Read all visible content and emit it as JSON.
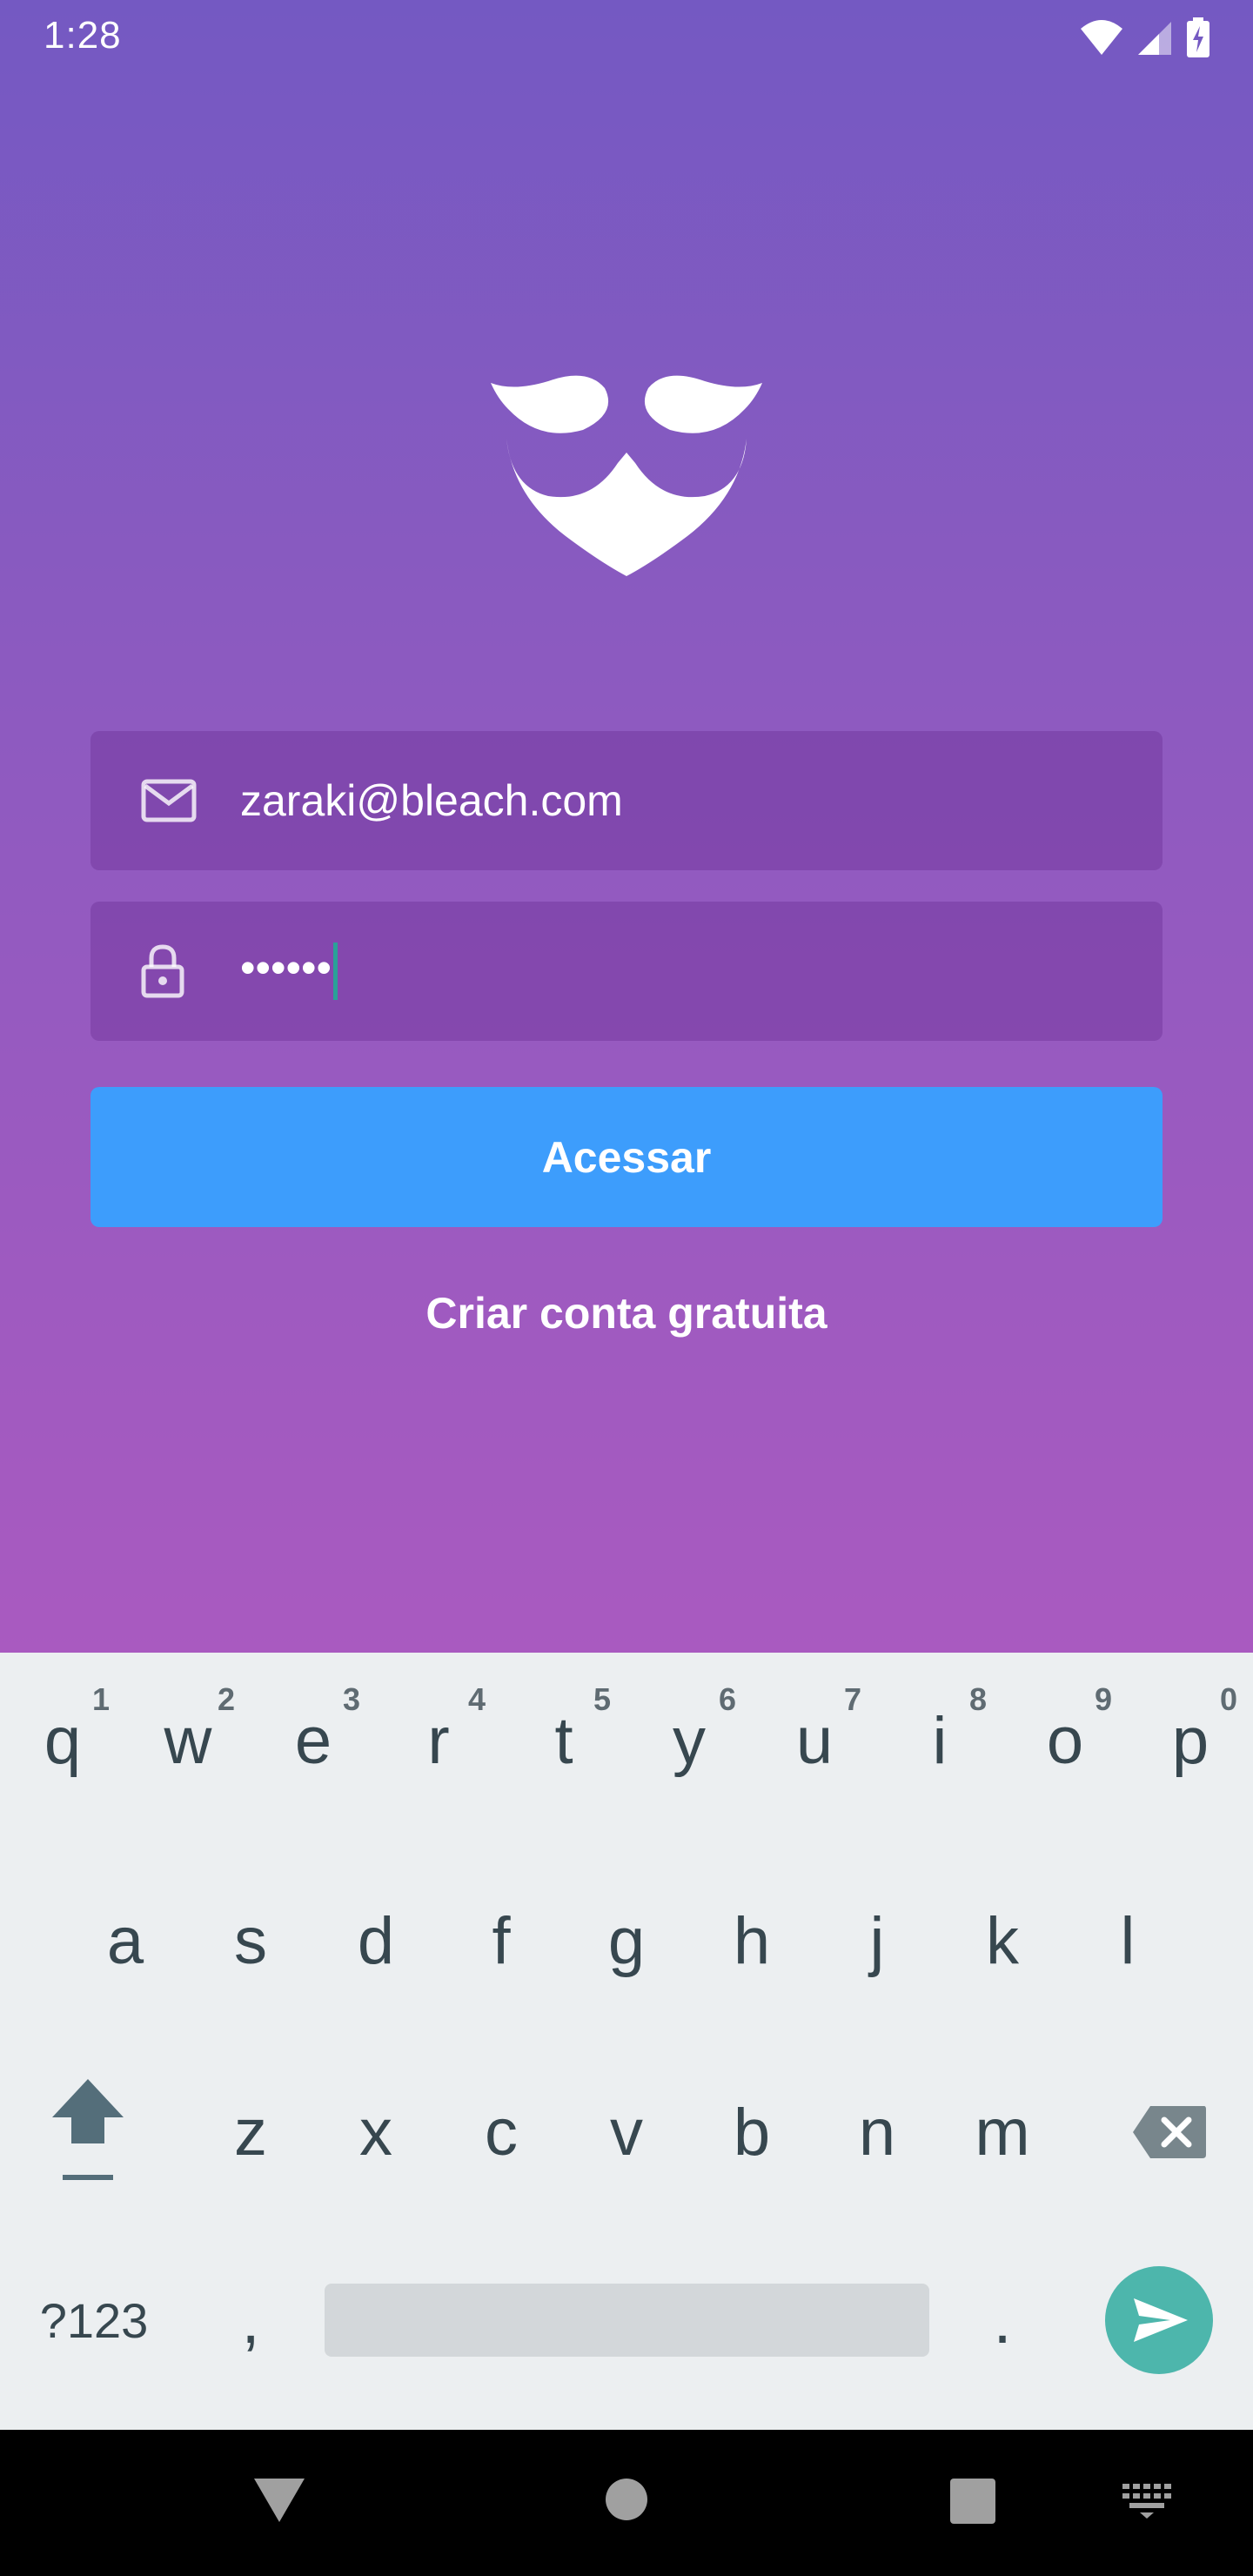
{
  "status_bar": {
    "time": "1:28",
    "icons": [
      "wifi-icon",
      "cell-signal-icon",
      "battery-charging-icon"
    ]
  },
  "login": {
    "logo": "mustache-beard-logo",
    "email_value": "zaraki@bleach.com",
    "password_value": "••••••",
    "submit_label": "Acessar",
    "create_account_label": "Criar conta gratuita"
  },
  "keyboard": {
    "row1": [
      {
        "key": "q",
        "hint": "1"
      },
      {
        "key": "w",
        "hint": "2"
      },
      {
        "key": "e",
        "hint": "3"
      },
      {
        "key": "r",
        "hint": "4"
      },
      {
        "key": "t",
        "hint": "5"
      },
      {
        "key": "y",
        "hint": "6"
      },
      {
        "key": "u",
        "hint": "7"
      },
      {
        "key": "i",
        "hint": "8"
      },
      {
        "key": "o",
        "hint": "9"
      },
      {
        "key": "p",
        "hint": "0"
      }
    ],
    "row2": [
      "a",
      "s",
      "d",
      "f",
      "g",
      "h",
      "j",
      "k",
      "l"
    ],
    "row3": [
      "z",
      "x",
      "c",
      "v",
      "b",
      "n",
      "m"
    ],
    "symbols_label": "?123",
    "comma": ",",
    "period": ".",
    "send_color": "#4db6ac"
  },
  "colors": {
    "gradient_top": "#7459c2",
    "gradient_bottom": "#a95ac0",
    "button": "#3d9dfc"
  }
}
